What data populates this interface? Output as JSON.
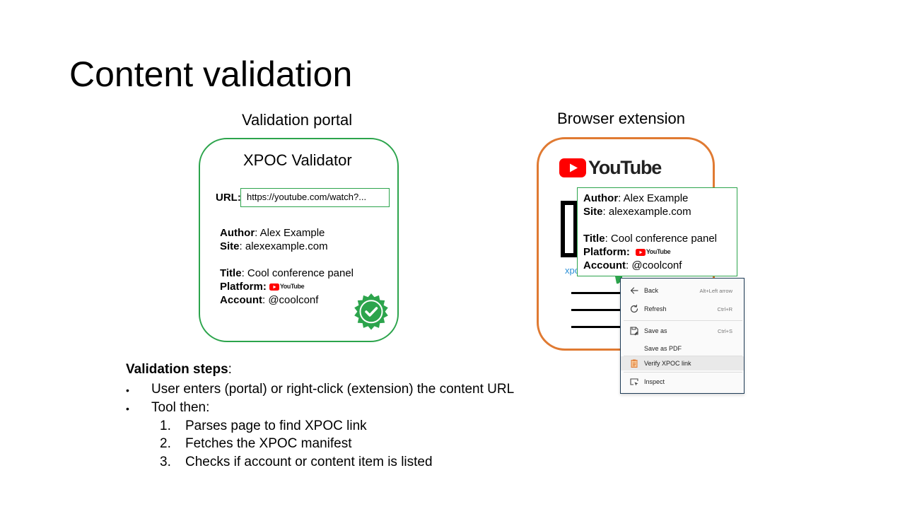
{
  "slide": {
    "title": "Content validation"
  },
  "portal": {
    "heading": "Validation portal",
    "app_title": "XPOC Validator",
    "url_label": "URL:",
    "url_value": "https://youtube.com/watch?...",
    "author_label": "Author",
    "author_value": ": Alex Example",
    "site_label": "Site",
    "site_value": ": alexexample.com",
    "title_label": "Title",
    "title_value": ": Cool conference panel",
    "platform_label": "Platform:",
    "platform_logo_text": "YouTube",
    "account_label": "Account",
    "account_value": ": @coolconf",
    "verified_icon": "verified-seal-icon",
    "accent_color": "#2ca44c"
  },
  "extension": {
    "heading": "Browser extension",
    "youtube_word": "YouTube",
    "partial_link": "xpo",
    "border_color": "#e07a32",
    "popup": {
      "author_label": "Author",
      "author_value": ": Alex Example",
      "site_label": "Site",
      "site_value": ": alexexample.com",
      "title_label": "Title",
      "title_value": ": Cool conference panel",
      "platform_label": "Platform:",
      "platform_logo_text": "YouTube",
      "account_label": "Account",
      "account_value": ": @coolconf"
    },
    "menu": [
      {
        "label": "Back",
        "shortcut": "Alt+Left arrow",
        "icon": "back-arrow-icon"
      },
      {
        "label": "Refresh",
        "shortcut": "Ctrl+R",
        "icon": "refresh-icon"
      },
      {
        "label": "Save as",
        "shortcut": "Ctrl+S",
        "icon": "save-as-icon"
      },
      {
        "label": "Save as PDF",
        "shortcut": "",
        "icon": ""
      },
      {
        "label": "Verify XPOC link",
        "shortcut": "",
        "icon": "xpoc-clipboard-icon"
      },
      {
        "label": "Inspect",
        "shortcut": "",
        "icon": "inspect-icon"
      }
    ]
  },
  "steps": {
    "heading": "Validation steps",
    "heading_colon": ":",
    "bullets": [
      "User enters (portal) or right-click (extension) the content URL",
      "Tool then:"
    ],
    "sub_numbers": [
      "1.",
      "2.",
      "3."
    ],
    "sub_steps": [
      "Parses page to find XPOC link",
      "Fetches the XPOC manifest",
      "Checks if account or content item is listed"
    ]
  }
}
